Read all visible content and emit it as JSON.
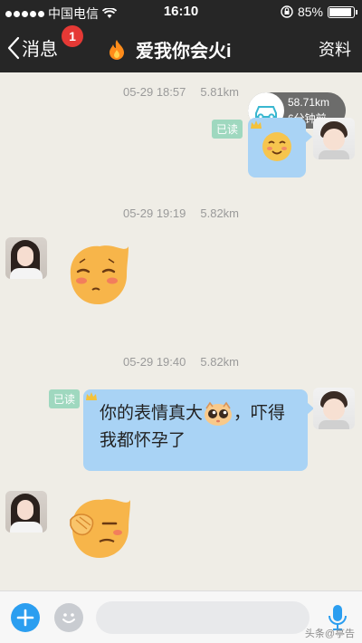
{
  "status_bar": {
    "carrier": "中国电信",
    "time": "16:10",
    "battery_percent": "85%",
    "battery_level": 0.85
  },
  "nav": {
    "back_label": "消息",
    "unread_badge": "1",
    "title": "爱我你会火i",
    "profile_label": "资料"
  },
  "messages": [
    {
      "stamp_date": "05-29 18:57",
      "stamp_distance": "5.81km",
      "read": "已读",
      "location_distance": "58.71km",
      "location_time": "6分钟前"
    },
    {
      "stamp_date": "05-29 19:19",
      "stamp_distance": "5.82km"
    },
    {
      "stamp_date": "05-29 19:40",
      "stamp_distance": "5.82km",
      "read": "已读",
      "text_part1": "你的表情真大",
      "text_part2": "，吓得我都怀孕了"
    }
  ],
  "input": {
    "placeholder": ""
  },
  "watermark": "头条@亭告",
  "colors": {
    "bubble_blue": "#a9d3f5",
    "accent_blue": "#2b9ef0",
    "badge_red": "#e53935"
  }
}
